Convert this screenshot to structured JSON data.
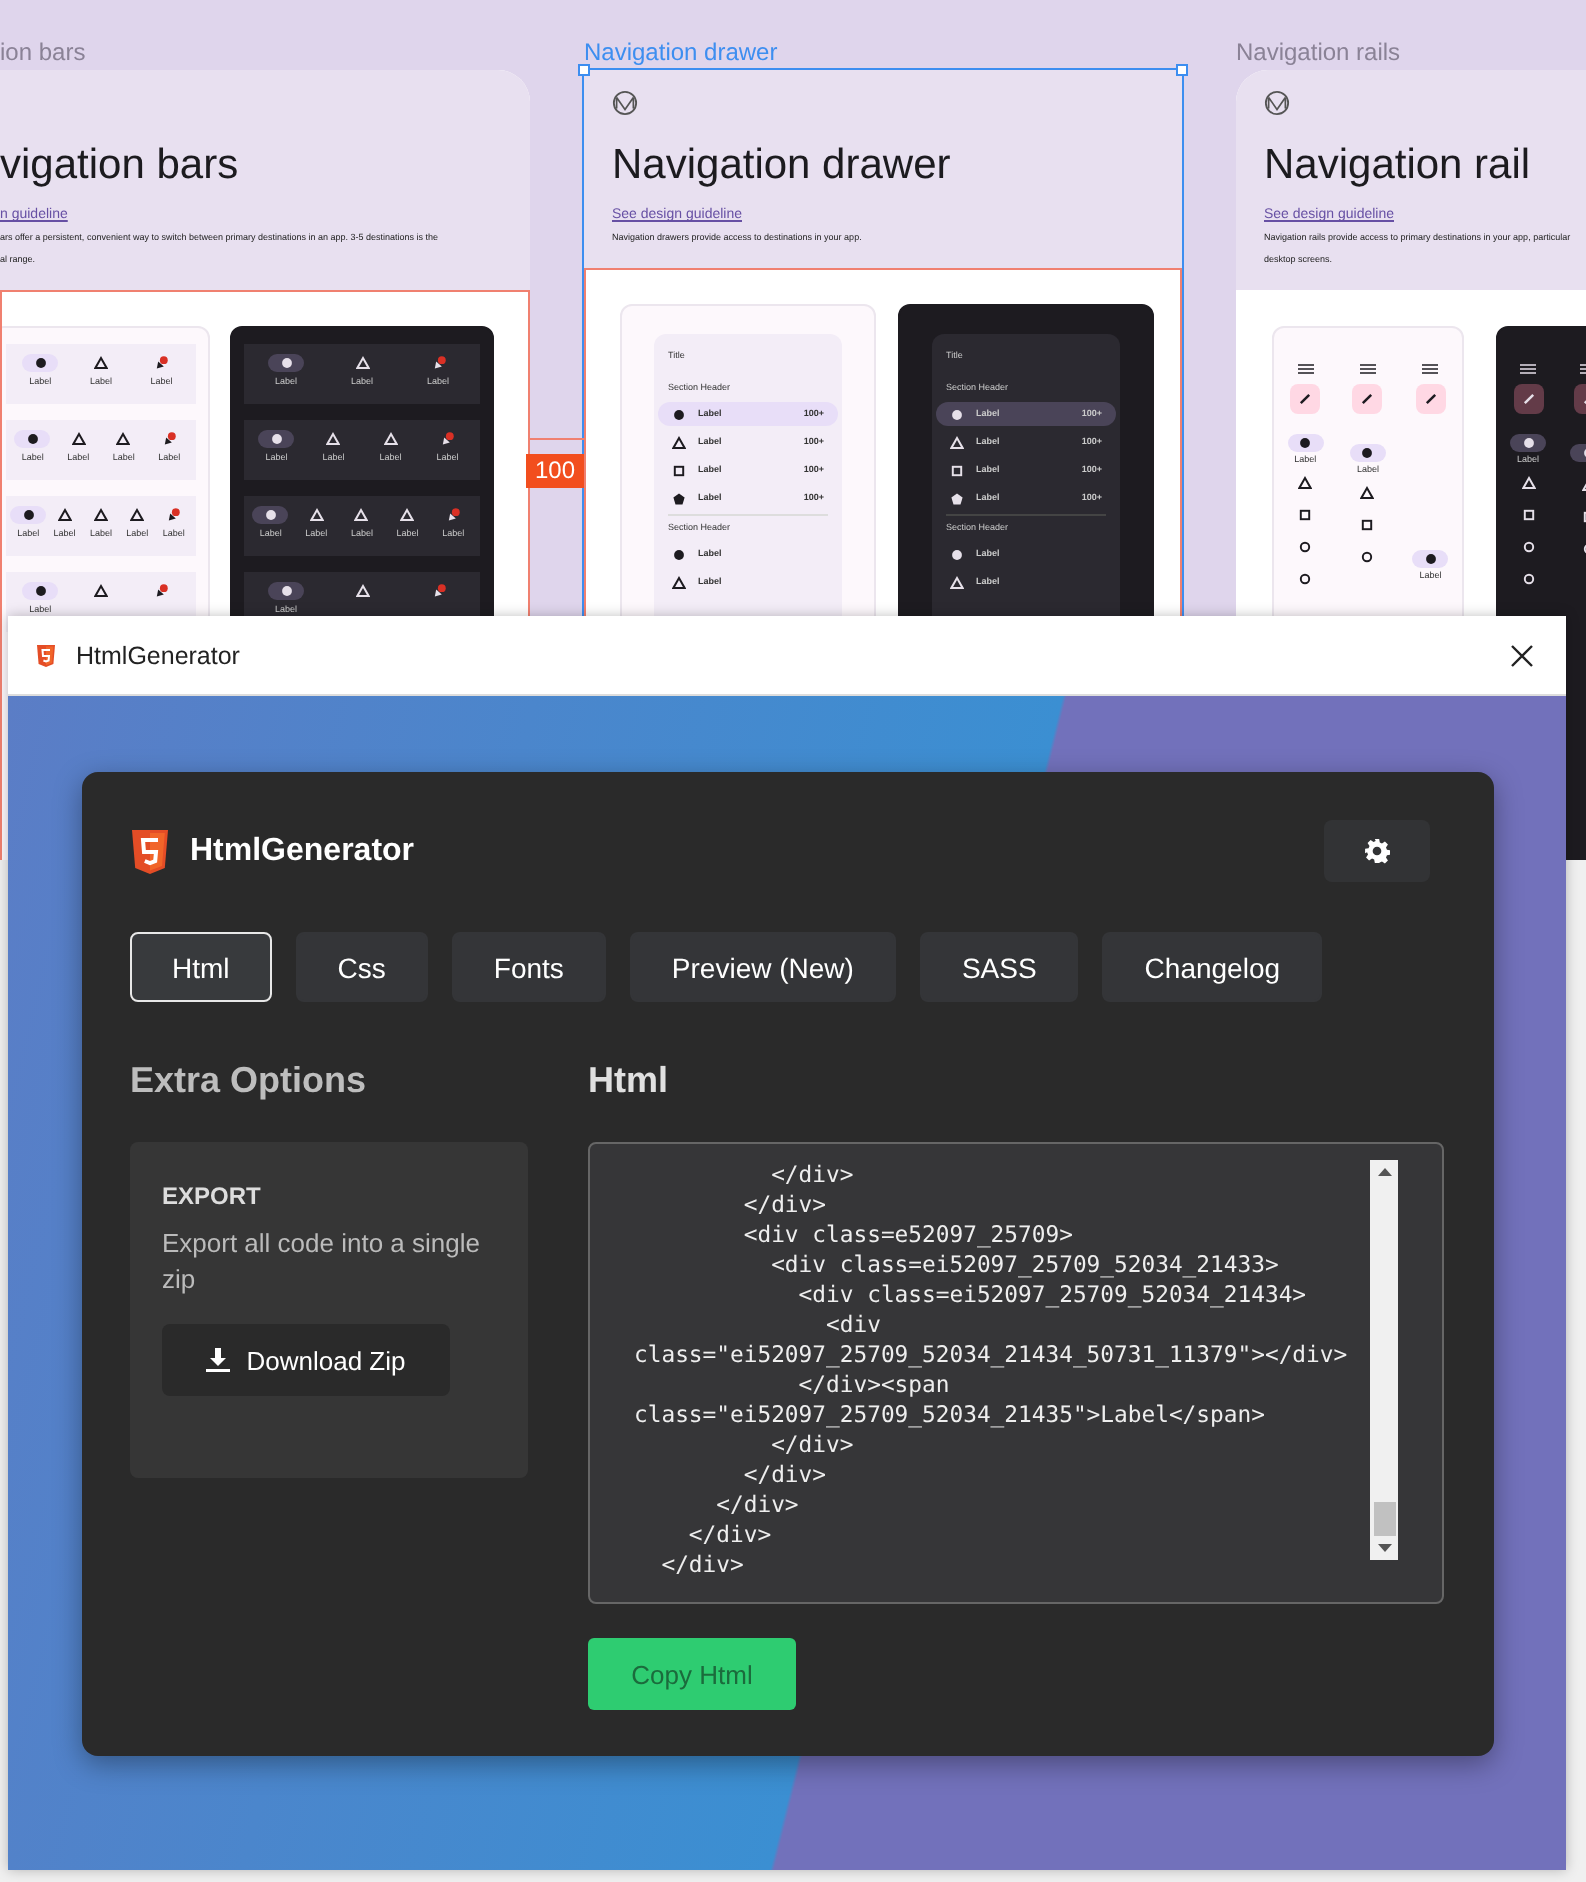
{
  "canvas": {
    "measurement": {
      "label": "100"
    },
    "frames": [
      {
        "kind": "bars",
        "label": "ion bars",
        "selected": false,
        "measured": true,
        "heading": "vigation bars",
        "link": "n guideline",
        "description": [
          "ars offer a persistent, convenient way to switch between primary destinations in an app. 3-5 destinations is the",
          "al range."
        ],
        "mockups": [
          {
            "bars": [
              {
                "items": [
                  {
                    "kind": "dot",
                    "label": "Label",
                    "selected": true
                  },
                  {
                    "kind": "triangle",
                    "label": "Label",
                    "selected": false
                  },
                  {
                    "kind": "badge",
                    "label": "Label",
                    "selected": false
                  }
                ]
              },
              {
                "items": [
                  {
                    "kind": "dot",
                    "label": "Label",
                    "selected": true
                  },
                  {
                    "kind": "triangle",
                    "label": "Label",
                    "selected": false
                  },
                  {
                    "kind": "triangle",
                    "label": "Label",
                    "selected": false
                  },
                  {
                    "kind": "badge",
                    "label": "Label",
                    "selected": false
                  }
                ]
              },
              {
                "items": [
                  {
                    "kind": "dot",
                    "label": "Label",
                    "selected": true
                  },
                  {
                    "kind": "triangle",
                    "label": "Label",
                    "selected": false
                  },
                  {
                    "kind": "triangle",
                    "label": "Label",
                    "selected": false
                  },
                  {
                    "kind": "triangle",
                    "label": "Label",
                    "selected": false
                  },
                  {
                    "kind": "badge",
                    "label": "Label",
                    "selected": false
                  }
                ]
              },
              {
                "items": [
                  {
                    "kind": "dot",
                    "label": "Label",
                    "selected": true
                  },
                  {
                    "kind": "triangle",
                    "selected": false
                  },
                  {
                    "kind": "badge",
                    "selected": false
                  }
                ]
              }
            ]
          },
          {
            "bars": [
              {
                "items": [
                  {
                    "kind": "dot",
                    "label": "Label",
                    "selected": true
                  },
                  {
                    "kind": "triangle",
                    "label": "Label",
                    "selected": false
                  },
                  {
                    "kind": "badge",
                    "label": "Label",
                    "selected": false
                  }
                ]
              },
              {
                "items": [
                  {
                    "kind": "dot",
                    "label": "Label",
                    "selected": true
                  },
                  {
                    "kind": "triangle",
                    "label": "Label",
                    "selected": false
                  },
                  {
                    "kind": "triangle",
                    "label": "Label",
                    "selected": false
                  },
                  {
                    "kind": "badge",
                    "label": "Label",
                    "selected": false
                  }
                ]
              },
              {
                "items": [
                  {
                    "kind": "dot",
                    "label": "Label",
                    "selected": true
                  },
                  {
                    "kind": "triangle",
                    "label": "Label",
                    "selected": false
                  },
                  {
                    "kind": "triangle",
                    "label": "Label",
                    "selected": false
                  },
                  {
                    "kind": "triangle",
                    "label": "Label",
                    "selected": false
                  },
                  {
                    "kind": "badge",
                    "label": "Label",
                    "selected": false
                  }
                ]
              },
              {
                "items": [
                  {
                    "kind": "dot",
                    "label": "Label",
                    "selected": true
                  },
                  {
                    "kind": "triangle",
                    "selected": false
                  },
                  {
                    "kind": "badge",
                    "selected": false
                  }
                ]
              }
            ]
          }
        ]
      },
      {
        "kind": "drawer",
        "label": "Navigation drawer",
        "selected": true,
        "measured": true,
        "heading": "Navigation drawer",
        "link": "See design guideline",
        "description": [
          "Navigation drawers provide access to destinations in your app."
        ],
        "mockups": [
          {
            "title": "Title",
            "sections": [
              {
                "header": "Section Header",
                "items": [
                  {
                    "kind": "dot",
                    "label": "Label",
                    "count": "100+",
                    "selected": true
                  },
                  {
                    "kind": "triangle",
                    "label": "Label",
                    "count": "100+",
                    "selected": false
                  },
                  {
                    "kind": "square",
                    "label": "Label",
                    "count": "100+",
                    "selected": false
                  },
                  {
                    "kind": "pentagon",
                    "label": "Label",
                    "count": "100+",
                    "selected": false
                  }
                ]
              },
              {
                "header": "Section Header",
                "items": [
                  {
                    "kind": "dot",
                    "label": "Label",
                    "selected": false
                  },
                  {
                    "kind": "triangle",
                    "label": "Label",
                    "selected": false
                  }
                ]
              }
            ]
          },
          {
            "title": "Title",
            "sections": [
              {
                "header": "Section Header",
                "items": [
                  {
                    "kind": "dot",
                    "label": "Label",
                    "count": "100+",
                    "selected": true
                  },
                  {
                    "kind": "triangle",
                    "label": "Label",
                    "count": "100+",
                    "selected": false
                  },
                  {
                    "kind": "square",
                    "label": "Label",
                    "count": "100+",
                    "selected": false
                  },
                  {
                    "kind": "pentagon",
                    "label": "Label",
                    "count": "100+",
                    "selected": false
                  }
                ]
              },
              {
                "header": "Section Header",
                "items": [
                  {
                    "kind": "dot",
                    "label": "Label",
                    "selected": false
                  },
                  {
                    "kind": "triangle",
                    "label": "Label",
                    "selected": false
                  }
                ]
              }
            ]
          }
        ]
      },
      {
        "kind": "rail",
        "label": "Navigation rails",
        "selected": false,
        "measured": false,
        "heading": "Navigation rail",
        "link": "See design guideline",
        "description": [
          "Navigation rails provide access to primary destinations in your app, particular",
          "desktop screens."
        ],
        "mockups": [
          {
            "columns": [
              {
                "items": [
                  {
                    "kind": "dot",
                    "label": "Label",
                    "selected": true
                  },
                  {
                    "kind": "triangle",
                    "selected": false
                  },
                  {
                    "kind": "square",
                    "selected": false
                  },
                  {
                    "kind": "circle",
                    "selected": false
                  },
                  {
                    "kind": "circle",
                    "selected": false
                  }
                ]
              },
              {
                "items": [
                  {
                    "kind": "dot",
                    "label": "Label",
                    "selected": true
                  },
                  {
                    "kind": "triangle",
                    "selected": false
                  },
                  {
                    "kind": "square",
                    "selected": false
                  },
                  {
                    "kind": "circle",
                    "selected": false
                  }
                ]
              },
              {
                "items": [
                  {
                    "kind": "dot",
                    "label": "Label",
                    "selected": true
                  }
                ]
              }
            ]
          },
          {
            "columns": [
              {
                "items": [
                  {
                    "kind": "dot",
                    "label": "Label",
                    "selected": true
                  },
                  {
                    "kind": "triangle",
                    "selected": false
                  },
                  {
                    "kind": "square",
                    "selected": false
                  },
                  {
                    "kind": "circle",
                    "selected": false
                  },
                  {
                    "kind": "circle",
                    "selected": false
                  }
                ]
              },
              {
                "items": [
                  {
                    "kind": "dot",
                    "selected": true
                  },
                  {
                    "kind": "triangle",
                    "selected": false
                  },
                  {
                    "kind": "square",
                    "selected": false
                  },
                  {
                    "kind": "circle",
                    "selected": false
                  }
                ]
              }
            ]
          }
        ]
      }
    ]
  },
  "window": {
    "title": "HtmlGenerator",
    "app_name": "HtmlGenerator",
    "tabs": [
      {
        "label": "Html",
        "selected": true
      },
      {
        "label": "Css",
        "selected": false
      },
      {
        "label": "Fonts",
        "selected": false
      },
      {
        "label": "Preview (New)",
        "selected": false
      },
      {
        "label": "SASS",
        "selected": false
      },
      {
        "label": "Changelog",
        "selected": false
      }
    ],
    "sidebar": {
      "heading": "Extra Options",
      "card_title": "EXPORT",
      "card_text": "Export all code into a single zip",
      "button": "Download Zip"
    },
    "editor": {
      "heading": "Html",
      "copy_button": "Copy Html",
      "code_lines": [
        "          </div>",
        "        </div>",
        "        <div class=e52097_25709>",
        "          <div class=ei52097_25709_52034_21433>",
        "            <div class=ei52097_25709_52034_21434>",
        "              <div",
        "class=\"ei52097_25709_52034_21434_50731_11379\"></div>",
        "            </div><span",
        "class=\"ei52097_25709_52034_21435\">Label</span>",
        "          </div>",
        "        </div>",
        "      </div>",
        "    </div>",
        "  </div>"
      ]
    }
  }
}
